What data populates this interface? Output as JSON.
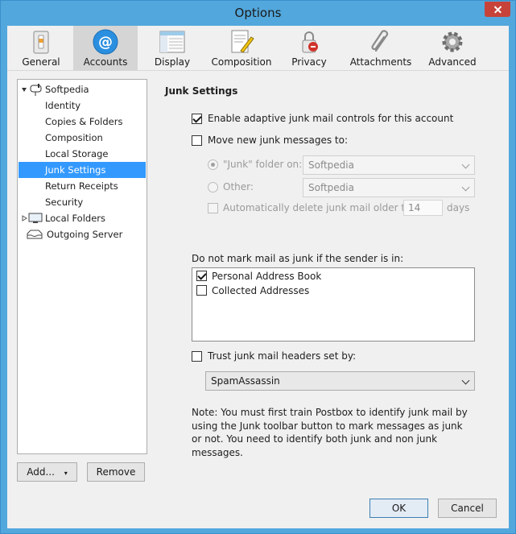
{
  "window": {
    "title": "Options",
    "close_label": "✕"
  },
  "toolbar": {
    "items": [
      {
        "label": "General",
        "icon": "general-icon"
      },
      {
        "label": "Accounts",
        "icon": "accounts-icon",
        "selected": true
      },
      {
        "label": "Display",
        "icon": "display-icon"
      },
      {
        "label": "Composition",
        "icon": "composition-icon"
      },
      {
        "label": "Privacy",
        "icon": "privacy-icon"
      },
      {
        "label": "Attachments",
        "icon": "attachments-icon"
      },
      {
        "label": "Advanced",
        "icon": "advanced-icon"
      }
    ]
  },
  "tree": {
    "account": "Softpedia",
    "items": [
      "Identity",
      "Copies & Folders",
      "Composition",
      "Local Storage",
      "Junk Settings",
      "Return Receipts",
      "Security"
    ],
    "selected": "Junk Settings",
    "local_folders": "Local Folders",
    "outgoing": "Outgoing Server"
  },
  "left_buttons": {
    "add": "Add...",
    "remove": "Remove"
  },
  "junk": {
    "title": "Junk Settings",
    "enable_adaptive": "Enable adaptive junk mail controls for this account",
    "move_messages": "Move new junk messages to:",
    "junk_folder_on": "\"Junk\" folder on:",
    "junk_folder_value": "Softpedia",
    "other": "Other:",
    "other_value": "Softpedia",
    "auto_delete": "Automatically delete junk mail older than",
    "days_value": "14",
    "days_label": "days",
    "whitelist_label": "Do not mark mail as junk if the sender is in:",
    "address_books": [
      {
        "name": "Personal Address Book",
        "checked": true
      },
      {
        "name": "Collected Addresses",
        "checked": false
      }
    ],
    "trust_headers": "Trust junk mail headers set by:",
    "trust_value": "SpamAssassin",
    "note": "Note: You must first train Postbox to identify junk mail by using the Junk toolbar button to mark messages as junk or not. You need to identify both junk and non junk messages."
  },
  "dialog_buttons": {
    "ok": "OK",
    "cancel": "Cancel"
  }
}
